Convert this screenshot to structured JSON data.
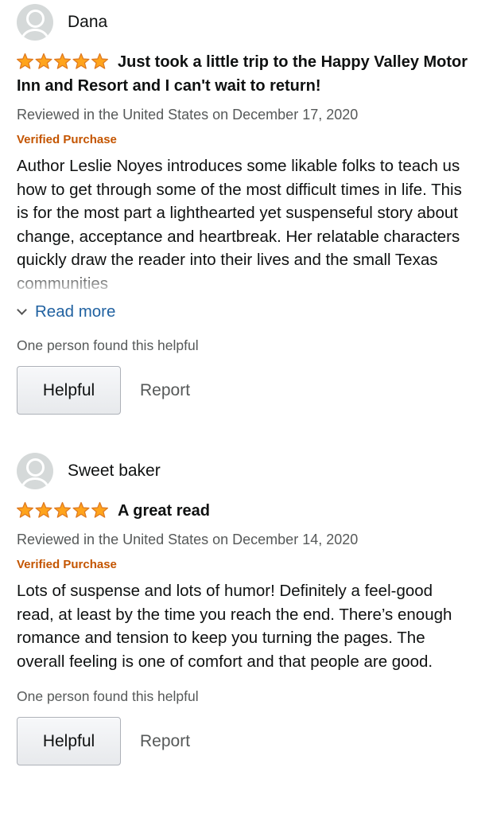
{
  "reviews": [
    {
      "reviewer": "Dana",
      "rating": 5,
      "max_rating": 5,
      "title": "Just took a little trip to the Happy Valley Motor Inn and Resort and I can't wait to return!",
      "date": "Reviewed in the United States on December 17, 2020",
      "badge": "Verified Purchase",
      "body": "Author Leslie Noyes introduces some likable folks to teach us how to get through some of the most difficult times in life. This is for the most part a lighthearted yet suspenseful story about change, acceptance and heartbreak. Her relatable characters quickly draw the reader into their lives and the small Texas communities",
      "read_more": "Read more",
      "helpful_count": "One person found this helpful",
      "helpful_button": "Helpful",
      "report_link": "Report"
    },
    {
      "reviewer": "Sweet baker",
      "rating": 5,
      "max_rating": 5,
      "title": "A great read",
      "date": "Reviewed in the United States on December 14, 2020",
      "badge": "Verified Purchase",
      "body": "Lots of suspense and lots of humor! Definitely a feel-good read, at least by the time you reach the end. There’s enough romance and tension to keep you turning the pages. The overall feeling is one of comfort and that people are good.",
      "helpful_count": "One person found this helpful",
      "helpful_button": "Helpful",
      "report_link": "Report"
    }
  ],
  "colors": {
    "star_fill": "#ffa41c",
    "star_stroke": "#de7921",
    "badge": "#c45500",
    "link": "#2162a1",
    "secondary_text": "#565959"
  },
  "icons": {
    "avatar": "user-avatar-icon",
    "star": "star-icon",
    "chevron": "chevron-down-icon"
  }
}
